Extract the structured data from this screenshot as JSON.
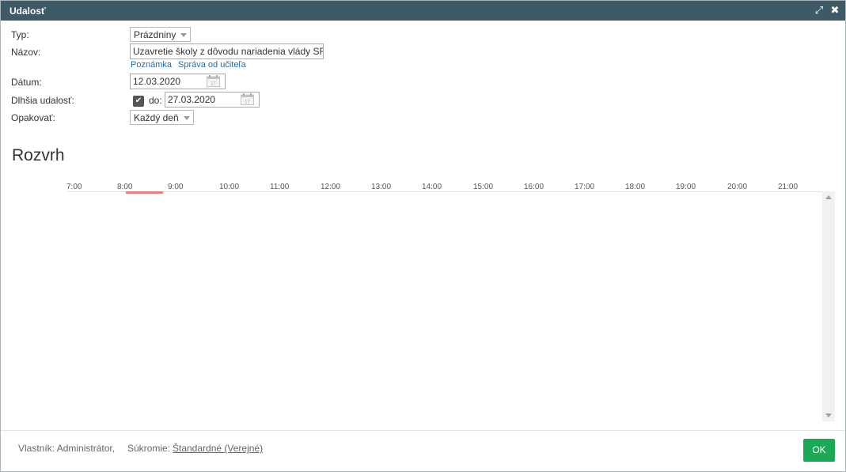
{
  "dialog": {
    "title": "Udalosť"
  },
  "form": {
    "typ_label": "Typ:",
    "typ_value": "Prázdniny",
    "nazov_label": "Názov:",
    "nazov_value": "Uzavretie školy z dôvodu nariadenia vlády SR",
    "poznamka_link": "Poznámka",
    "sprava_link": "Správa od učiteľa",
    "datum_label": "Dátum:",
    "datum_value": "12.03.2020",
    "dlhsia_label": "Dlhšia udalosť:",
    "do_label": "do:",
    "do_value": "27.03.2020",
    "opakovat_label": "Opakovať:",
    "opakovat_value": "Každý deň",
    "calendar_day": "17"
  },
  "schedule": {
    "heading": "Rozvrh",
    "hours": [
      "7:00",
      "8:00",
      "9:00",
      "10:00",
      "11:00",
      "12:00",
      "13:00",
      "14:00",
      "15:00",
      "16:00",
      "17:00",
      "18:00",
      "19:00",
      "20:00",
      "21:00"
    ]
  },
  "footer": {
    "owner": "Vlastník: Administrátor,",
    "privacy_label": "Súkromie:",
    "privacy_value": "Štandardné (Verejné)",
    "ok_label": "OK"
  },
  "icons": {
    "expand": "expand-icon",
    "close": "close-icon",
    "calendar": "calendar-icon",
    "check": "checkmark-icon"
  },
  "colors": {
    "titlebar": "#3e5a66",
    "ok_button": "#1aaa55",
    "link": "#1a6fb3",
    "event_marker": "#e88080"
  }
}
